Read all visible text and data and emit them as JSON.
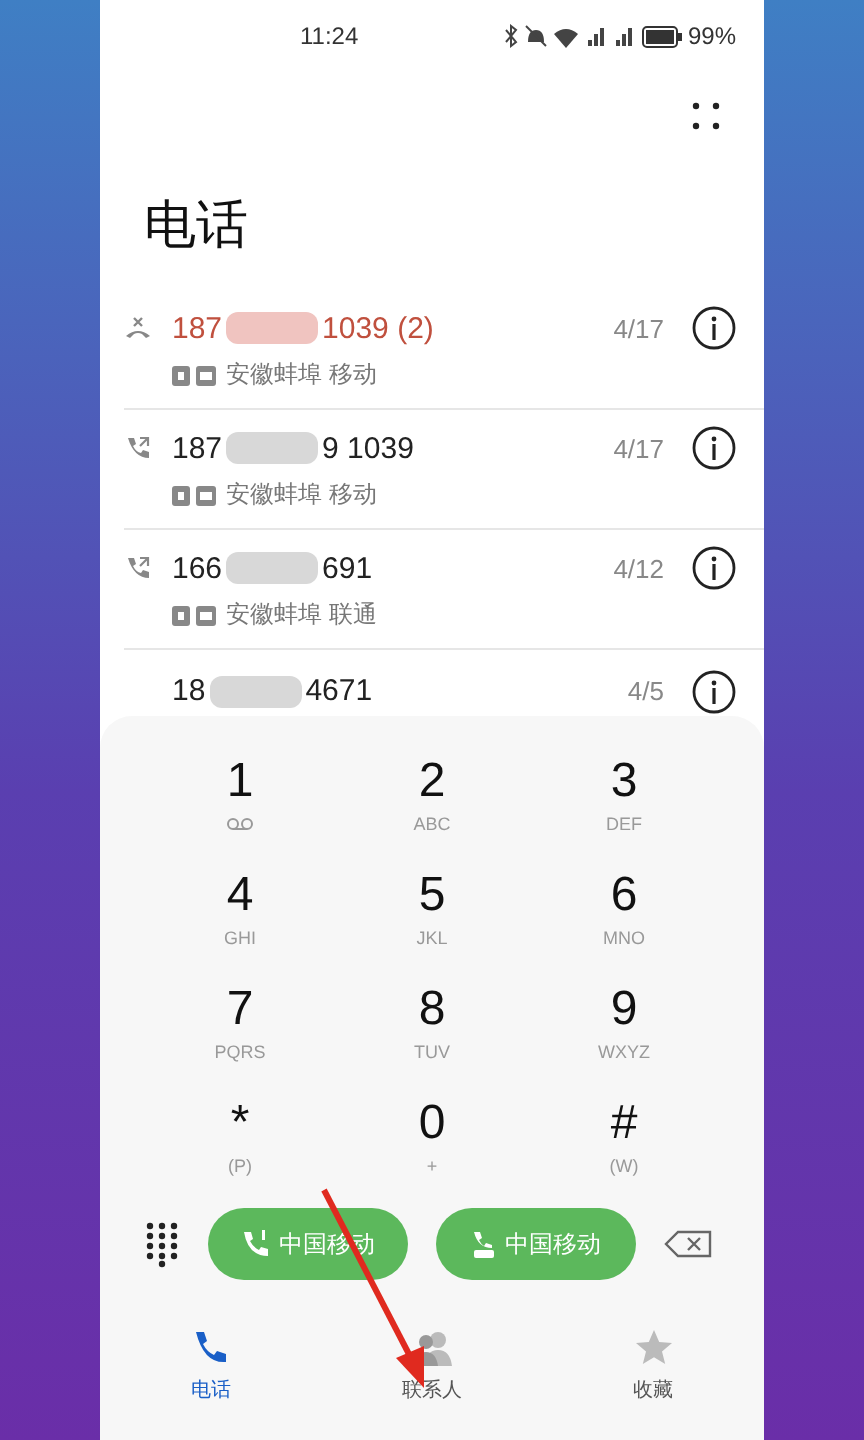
{
  "status_bar": {
    "time": "11:24",
    "battery": "99%"
  },
  "title": "电话",
  "calls": [
    {
      "kind": "missed",
      "number_start": "187",
      "number_end": "1039 (2)",
      "location": "安徽蚌埠 移动",
      "date": "4/17"
    },
    {
      "kind": "outgoing",
      "number_start": "187",
      "number_end": "9 1039",
      "location": "安徽蚌埠 移动",
      "date": "4/17"
    },
    {
      "kind": "outgoing",
      "number_start": "166",
      "number_end": "691",
      "location": "安徽蚌埠 联通",
      "date": "4/12"
    },
    {
      "kind": "none",
      "number_start": "18",
      "number_end": "4671",
      "date": "4/5"
    }
  ],
  "keys": [
    {
      "digit": "1",
      "kind": "voicemail"
    },
    {
      "digit": "2",
      "letters": "ABC"
    },
    {
      "digit": "3",
      "letters": "DEF"
    },
    {
      "digit": "4",
      "letters": "GHI"
    },
    {
      "digit": "5",
      "letters": "JKL"
    },
    {
      "digit": "6",
      "letters": "MNO"
    },
    {
      "digit": "7",
      "letters": "PQRS"
    },
    {
      "digit": "8",
      "letters": "TUV"
    },
    {
      "digit": "9",
      "letters": "WXYZ"
    },
    {
      "digit": "*",
      "letters": "(P)"
    },
    {
      "digit": "0",
      "letters": "+"
    },
    {
      "digit": "#",
      "letters": "(W)"
    }
  ],
  "call_buttons": [
    {
      "label": "中国移动",
      "kind": "sim1"
    },
    {
      "label": "中国移动",
      "kind": "hd"
    }
  ],
  "nav": [
    {
      "label": "电话",
      "kind": "phone",
      "selected": true
    },
    {
      "label": "联系人",
      "kind": "contacts",
      "selected": false
    },
    {
      "label": "收藏",
      "kind": "star",
      "selected": false
    }
  ]
}
